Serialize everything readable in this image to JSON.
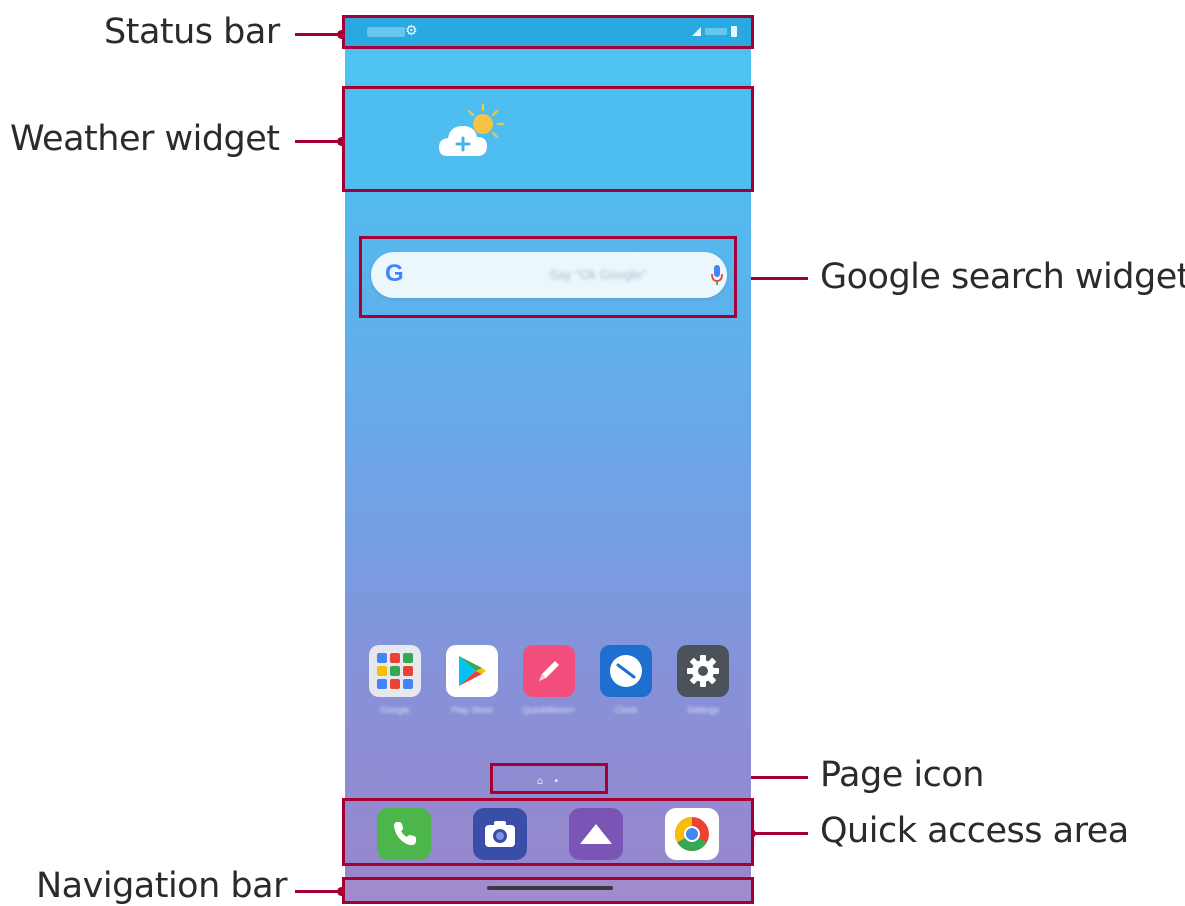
{
  "callouts": {
    "status_bar": "Status bar",
    "weather_widget": "Weather widget",
    "google_search_widget": "Google search widget",
    "page_icon": "Page icon",
    "quick_access_area": "Quick access area",
    "navigation_bar": "Navigation bar"
  },
  "search": {
    "hint": "Say \"Ok Google\""
  },
  "apps": [
    {
      "name": "folder",
      "label": "Google"
    },
    {
      "name": "play-store",
      "label": "Play Store"
    },
    {
      "name": "qmemo",
      "label": "QuickMemo+"
    },
    {
      "name": "clock",
      "label": "Clock"
    },
    {
      "name": "settings",
      "label": "Settings"
    }
  ],
  "dock_apps": [
    "phone",
    "camera",
    "gallery",
    "chrome"
  ],
  "colors": {
    "callout_accent": "#a50034",
    "status_bar": "#2aa9e0"
  }
}
